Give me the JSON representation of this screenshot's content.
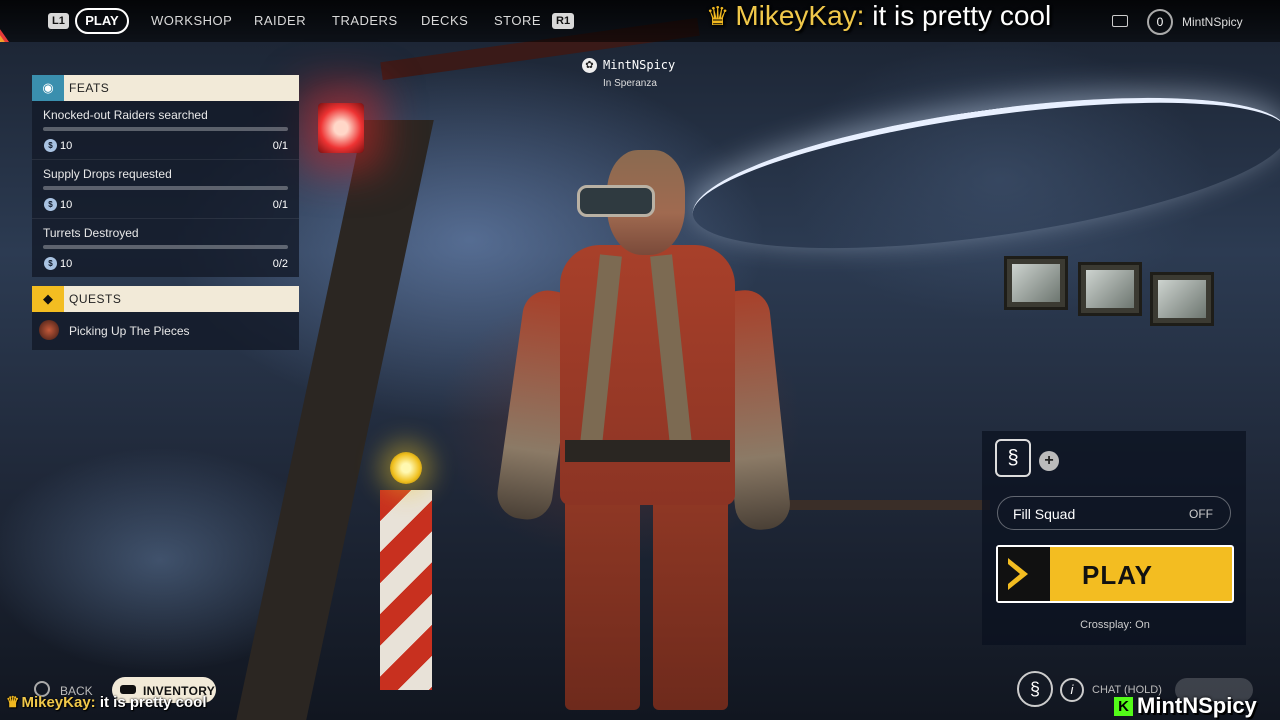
{
  "nav": {
    "left_hint": "L1",
    "right_hint": "R1",
    "active": "PLAY",
    "items": [
      "WORKSHOP",
      "RAIDER",
      "TRADERS",
      "DECKS",
      "STORE"
    ]
  },
  "chat_overlay": {
    "user": "MikeyKay:",
    "message": "it is pretty cool"
  },
  "player": {
    "level": "0",
    "name": "MintNSpicy"
  },
  "center_player": {
    "name": "MintNSpicy",
    "location": "In Speranza"
  },
  "feats": {
    "title": "FEATS",
    "items": [
      {
        "name": "Knocked-out Raiders searched",
        "reward": "10",
        "progress": "0/1",
        "fraction": 0
      },
      {
        "name": "Supply Drops requested",
        "reward": "10",
        "progress": "0/1",
        "fraction": 0
      },
      {
        "name": "Turrets Destroyed",
        "reward": "10",
        "progress": "0/2",
        "fraction": 0
      }
    ]
  },
  "quests": {
    "title": "QUESTS",
    "items": [
      {
        "name": "Picking Up The Pieces"
      }
    ]
  },
  "squad": {
    "fill_label": "Fill Squad",
    "fill_value": "OFF",
    "play_label": "PLAY",
    "crossplay": "Crossplay: On"
  },
  "bottom": {
    "back": "BACK",
    "inventory": "INVENTORY",
    "chat_hold": "CHAT (HOLD)"
  },
  "bottom_chat": {
    "user": "MikeyKay:",
    "message": "it is pretty cool"
  },
  "streamer_tag": "MintNSpicy",
  "colors": {
    "accent_yellow": "#f3bd21",
    "panel_header": "#f2ead8",
    "chat_name": "#f0c84a",
    "kick_green": "#53fc18"
  }
}
